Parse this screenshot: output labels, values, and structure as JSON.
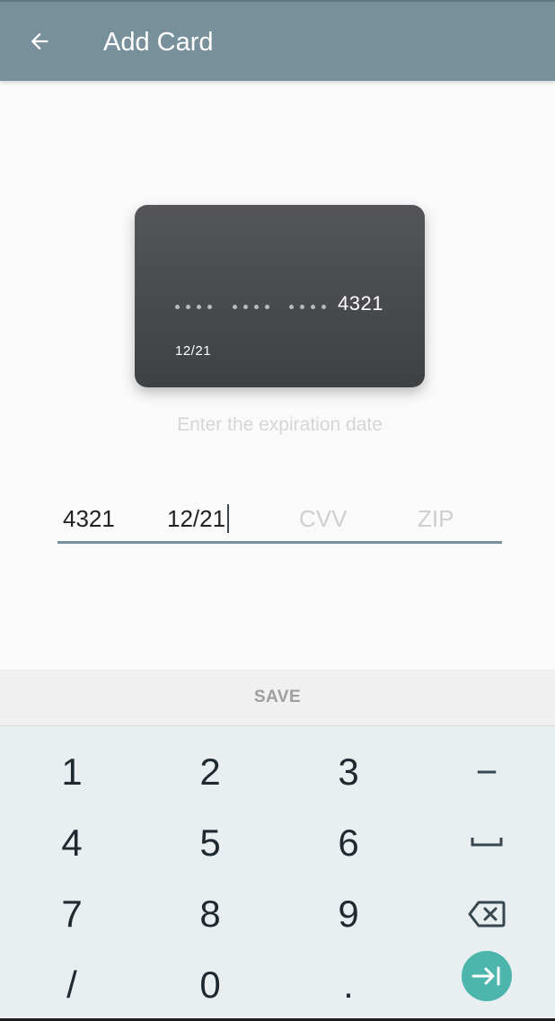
{
  "appbar": {
    "title": "Add Card",
    "back_icon": "arrow-left-icon"
  },
  "card": {
    "masked_dots": "•••• •••• ••••",
    "last4": "4321",
    "expiry": "12/21"
  },
  "hint": "Enter the expiration date",
  "fields": {
    "card_last4": "4321",
    "expiry": "12/21",
    "cvv_placeholder": "CVV",
    "zip_placeholder": "ZIP"
  },
  "save_label": "SAVE",
  "keypad": {
    "digits": [
      "1",
      "2",
      "3",
      "4",
      "5",
      "6",
      "7",
      "8",
      "9",
      "/",
      "0",
      "."
    ],
    "minus": "−",
    "space_icon": "space-icon",
    "backspace_icon": "backspace-icon",
    "next_icon": "next-field-icon"
  },
  "colors": {
    "appbar": "#78909c",
    "underline": "#78909c",
    "card": "#4a4c4f",
    "accent": "#4db6ac",
    "keyboard": "#e9eef1"
  }
}
